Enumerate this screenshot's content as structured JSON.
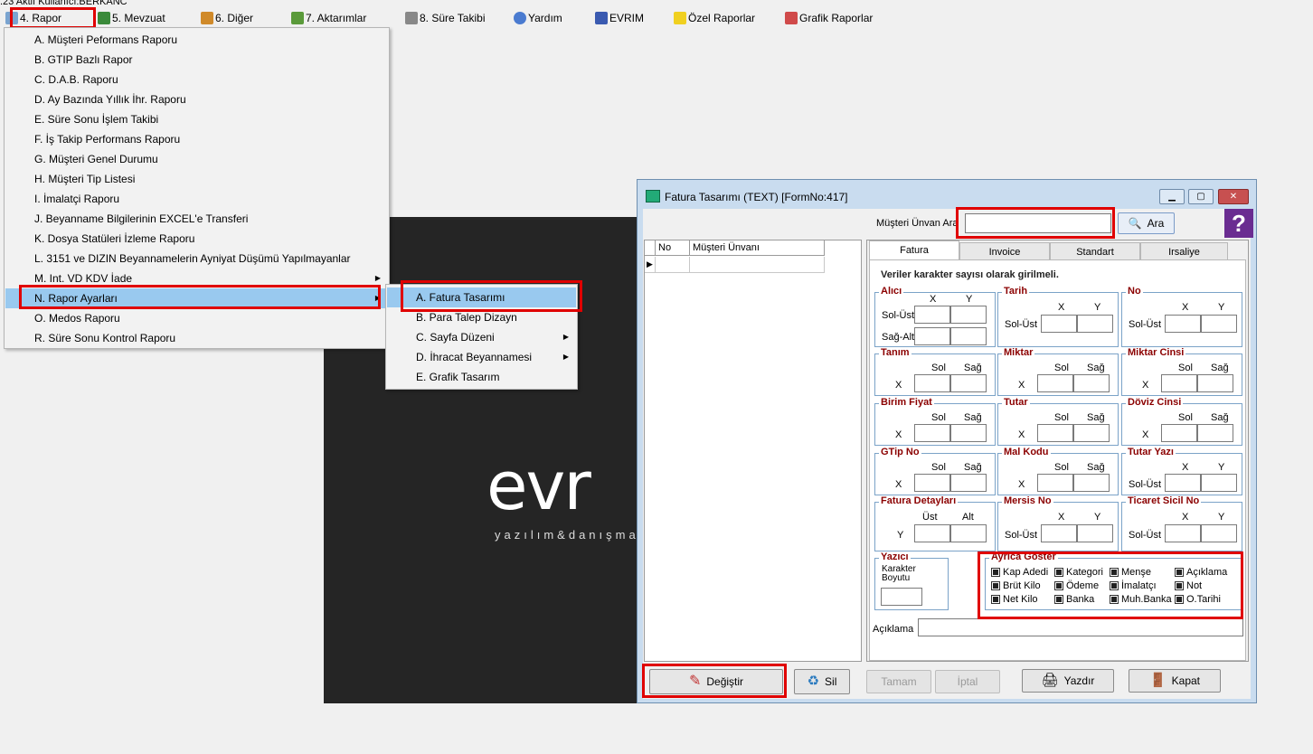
{
  "top_strip": ".23 Aktif Kullanıcı:BERKANC",
  "menubar": [
    {
      "label": "4.  Rapor"
    },
    {
      "label": "5.  Mevzuat"
    },
    {
      "label": "6.  Diğer"
    },
    {
      "label": "7.  Aktarımlar"
    },
    {
      "label": "8. Süre Takibi"
    },
    {
      "label": "Yardım"
    },
    {
      "label": "EVRIM"
    },
    {
      "label": "Özel Raporlar"
    },
    {
      "label": "Grafik Raporlar"
    }
  ],
  "dropdown": [
    "A.  Müşteri Peformans Raporu",
    "B.  GTIP Bazlı Rapor",
    "C.  D.A.B. Raporu",
    "D.  Ay Bazında Yıllık İhr. Raporu",
    "E.  Süre Sonu İşlem Takibi",
    "F.  İş Takip Performans Raporu",
    "G.  Müşteri Genel Durumu",
    "H.  Müşteri Tip Listesi",
    "I.  İmalatçi Raporu",
    "J.  Beyanname Bilgilerinin EXCEL'e Transferi",
    "K.  Dosya Statüleri İzleme Raporu",
    "L.  3151 ve DIZIN Beyannamelerin Ayniyat Düşümü Yapılmayanlar",
    "M. Int. VD KDV İade",
    "N.  Rapor Ayarları",
    "O. Medos Raporu",
    "R.  Süre Sonu Kontrol Raporu"
  ],
  "submenu": [
    "A.  Fatura Tasarımı",
    "B.  Para Talep Dizayn",
    "C.  Sayfa Düzeni",
    "D.  İhracat Beyannamesi",
    "E.  Grafik Tasarım"
  ],
  "splash": {
    "logo": "evr",
    "tagline": "yazılım&danışma"
  },
  "window": {
    "title": "Fatura Tasarımı (TEXT) [FormNo:417]",
    "search_label": "Müşteri Ünvan Ara",
    "search_value": "",
    "search_button": "Ara",
    "grid_headers": [
      "No",
      "Müşteri Ünvanı"
    ],
    "tabs": [
      "Fatura",
      "Invoice",
      "Standart",
      "Irsaliye"
    ],
    "note": "Veriler karakter sayısı olarak girilmeli.",
    "groups": {
      "alici": "Alıcı",
      "tarih": "Tarih",
      "no": "No",
      "tanim": "Tanım",
      "miktar": "Miktar",
      "miktar_cinsi": "Miktar Cinsi",
      "birim_fiyat": "Birim Fiyat",
      "tutar": "Tutar",
      "doviz_cinsi": "Döviz Cinsi",
      "gtip_no": "GTip No",
      "mal_kodu": "Mal Kodu",
      "tutar_yazi": "Tutar Yazı",
      "fatura_detaylari": "Fatura Detayları",
      "mersis_no": "Mersis No",
      "ticaret_sicil_no": "Ticaret Sicil No",
      "yazici": "Yazıcı",
      "ayrica_goster": "Ayrıca Göster"
    },
    "labels": {
      "x": "X",
      "y": "Y",
      "sol": "Sol",
      "sag": "Sağ",
      "sol_ust": "Sol-Üst",
      "sag_alt": "Sağ-Alt",
      "ust": "Üst",
      "alt": "Alt",
      "karakter_boyutu": "Karakter Boyutu",
      "aciklama": "Açıklama"
    },
    "checkboxes": [
      "Kap Adedi",
      "Kategori",
      "Menşe",
      "Açıklama",
      "Brüt Kilo",
      "Ödeme",
      "İmalatçı",
      "Not",
      "Net Kilo",
      "Banka",
      "Muh.Banka",
      "O.Tarihi"
    ],
    "buttons": {
      "degistir": "Değiştir",
      "sil": "Sil",
      "tamam": "Tamam",
      "iptal": "İptal",
      "yazdir": "Yazdır",
      "kapat": "Kapat"
    }
  }
}
